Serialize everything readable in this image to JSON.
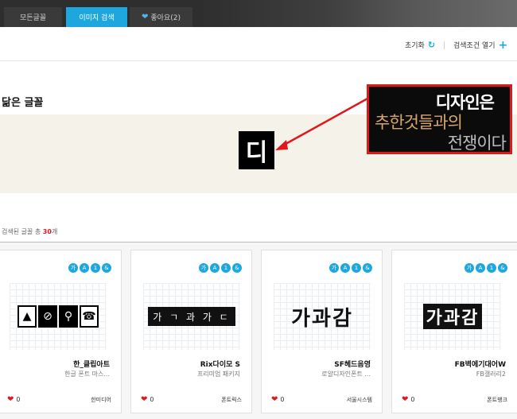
{
  "tabs": [
    {
      "label": "모든글꼴"
    },
    {
      "label": "이미지 검색"
    },
    {
      "label": "좋아요(2)"
    }
  ],
  "toolbar": {
    "reset_label": "초기화",
    "open_label": "검색조건 열기"
  },
  "section": {
    "title": "닮은 글꼴"
  },
  "preview": {
    "char": "디"
  },
  "annotation": {
    "line1": "디자인은",
    "line2": "추한것들과의",
    "line3": "전쟁이다"
  },
  "results": {
    "prefix": "검색된 글꼴 총",
    "count": "30",
    "suffix": "개"
  },
  "badges": [
    "가",
    "A",
    "1",
    "&"
  ],
  "cards": [
    {
      "name": "한_클립아트",
      "sub": "한글 폰트 마스...",
      "likes": "0",
      "maker": "한미디어",
      "sample": [
        "👤",
        "🚲",
        "☎"
      ]
    },
    {
      "name": "Rix다이모 S",
      "sub": "프리미엄 패키지",
      "likes": "0",
      "maker": "폰트릭스",
      "sample": "가 ㄱ 과 가 ㄷ"
    },
    {
      "name": "SF헤드음영",
      "sub": "로얄디자인폰트 ...",
      "likes": "0",
      "maker": "서울시스템",
      "sample": "가과감"
    },
    {
      "name": "FB벽에기대어W",
      "sub": "FB갤러리2",
      "likes": "0",
      "maker": "폰트뱅크",
      "sample": "가과감"
    }
  ],
  "colors": {
    "accent": "#1ea6df",
    "highlight": "#e0171b"
  }
}
